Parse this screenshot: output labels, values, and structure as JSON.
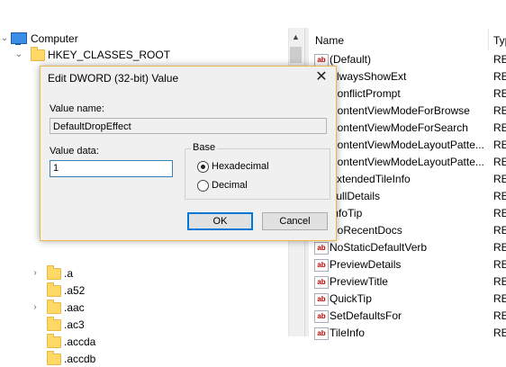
{
  "tree": {
    "root_label": "Computer",
    "hive_label": "HKEY_CLASSES_ROOT",
    "items": [
      ".a",
      ".a52",
      ".aac",
      ".ac3",
      ".accda",
      ".accdb"
    ]
  },
  "list": {
    "header_name": "Name",
    "header_type": "Typ",
    "rows": [
      {
        "name": "(Default)",
        "type": "RE"
      },
      {
        "name": "AlwaysShowExt",
        "type": "RE"
      },
      {
        "name": "ConflictPrompt",
        "type": "RE"
      },
      {
        "name": "ContentViewModeForBrowse",
        "type": "RE"
      },
      {
        "name": "ContentViewModeForSearch",
        "type": "RE"
      },
      {
        "name": "ContentViewModeLayoutPatte...",
        "type": "RE"
      },
      {
        "name": "ContentViewModeLayoutPatte...",
        "type": "RE"
      },
      {
        "name": "ExtendedTileInfo",
        "type": "RE"
      },
      {
        "name": "FullDetails",
        "type": "RE"
      },
      {
        "name": "InfoTip",
        "type": "RE"
      },
      {
        "name": "NoRecentDocs",
        "type": "RE"
      },
      {
        "name": "NoStaticDefaultVerb",
        "type": "RE"
      },
      {
        "name": "PreviewDetails",
        "type": "RE"
      },
      {
        "name": "PreviewTitle",
        "type": "RE"
      },
      {
        "name": "QuickTip",
        "type": "RE"
      },
      {
        "name": "SetDefaultsFor",
        "type": "RE"
      },
      {
        "name": "TileInfo",
        "type": "RE"
      }
    ]
  },
  "dialog": {
    "title": "Edit DWORD (32-bit) Value",
    "close_glyph": "✕",
    "value_name_label": "Value name:",
    "value_name": "DefaultDropEffect",
    "value_data_label": "Value data:",
    "value_data": "1",
    "base_label": "Base",
    "hex_label": "Hexadecimal",
    "dec_label": "Decimal",
    "base_selected": "Hexadecimal",
    "ok_label": "OK",
    "cancel_label": "Cancel"
  }
}
